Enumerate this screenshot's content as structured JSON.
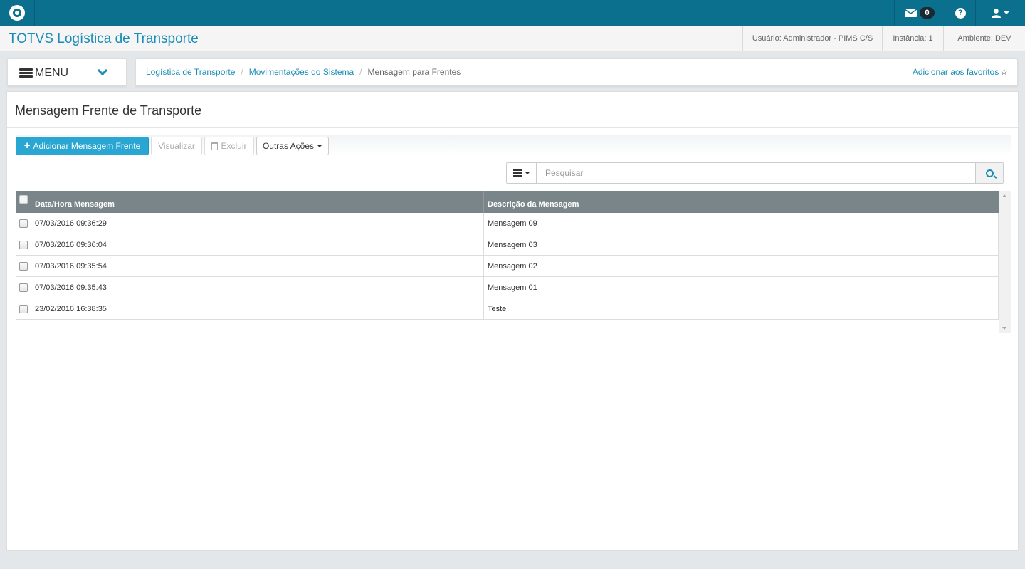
{
  "topbar": {
    "mail_count": "0",
    "icons": {
      "logo": "totvs-logo-icon",
      "mail": "envelope-icon",
      "help": "question-circle-icon",
      "user": "user-icon"
    }
  },
  "header": {
    "app_title": "TOTVS Logística de Transporte",
    "user": "Usuário: Administrador - PIMS C/S",
    "instance": "Instância: 1",
    "environment": "Ambiente: DEV"
  },
  "menu": {
    "label": "MENU"
  },
  "breadcrumb": {
    "items": [
      "Logística de Transporte",
      "Movimentações do Sistema"
    ],
    "current": "Mensagem para Frentes",
    "favorites": "Adicionar aos favoritos"
  },
  "page": {
    "title": "Mensagem Frente de Transporte"
  },
  "toolbar": {
    "add_label": "Adicionar Mensagem Frente",
    "view_label": "Visualizar",
    "delete_label": "Excluir",
    "other_label": "Outras Ações"
  },
  "search": {
    "placeholder": "Pesquisar",
    "value": ""
  },
  "table": {
    "columns": [
      "Data/Hora Mensagem",
      "Descrição da Mensagem"
    ],
    "rows": [
      {
        "datetime": "07/03/2016 09:36:29",
        "description": "Mensagem 09"
      },
      {
        "datetime": "07/03/2016 09:36:04",
        "description": "Mensagem 03"
      },
      {
        "datetime": "07/03/2016 09:35:54",
        "description": "Mensagem 02"
      },
      {
        "datetime": "07/03/2016 09:35:43",
        "description": "Mensagem 01"
      },
      {
        "datetime": "23/02/2016 16:38:35",
        "description": "Teste"
      }
    ]
  },
  "colors": {
    "topbar": "#0b6f8e",
    "accent": "#1a8cb6",
    "primary_button": "#29a6d1",
    "table_header": "#7a8589"
  }
}
